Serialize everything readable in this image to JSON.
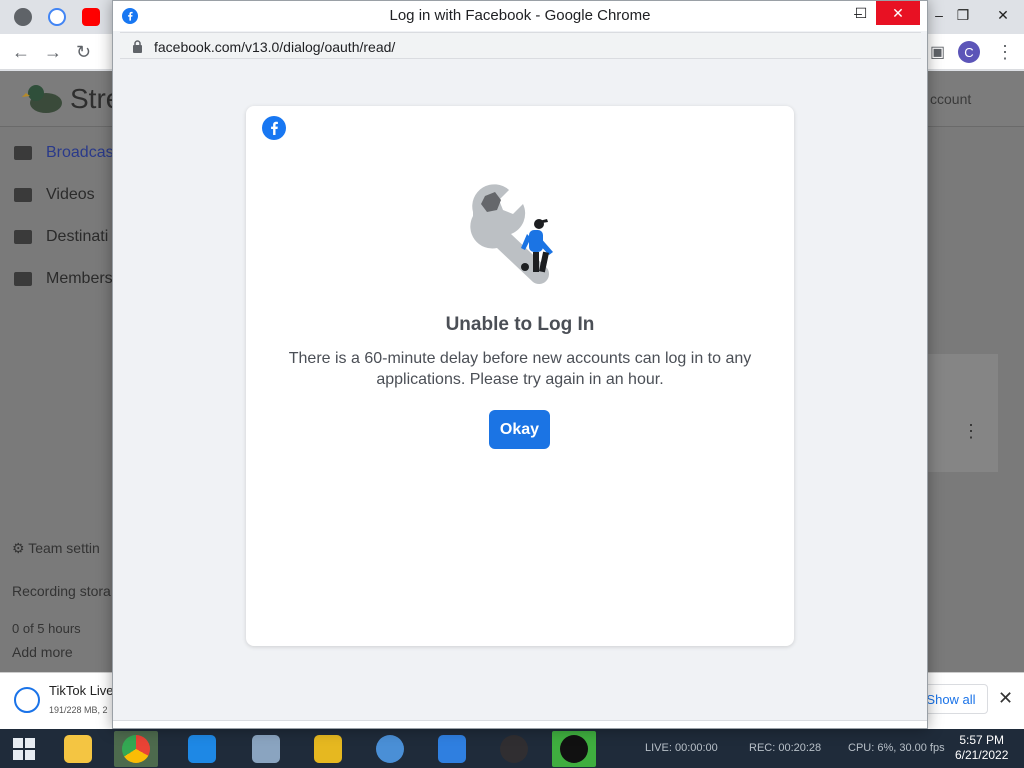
{
  "background": {
    "site_title": "Stre",
    "account_label": "ccount",
    "nav": [
      {
        "label": "Broadcas",
        "icon": "video-camera-icon"
      },
      {
        "label": "Videos",
        "icon": "video-library-icon"
      },
      {
        "label": "Destinati",
        "icon": "share-icon"
      },
      {
        "label": "Members",
        "icon": "people-icon"
      }
    ],
    "team_settings": "Team settin",
    "recording_storage": "Recording stora",
    "storage_used": "0 of 5 hours",
    "add_more": "Add more",
    "avatar_letter": "C"
  },
  "download": {
    "title": "TikTok Live",
    "subtitle": "191/228 MB, 2",
    "show_all": "Show all"
  },
  "popup": {
    "window_title": "Log in with Facebook - Google Chrome",
    "url": "facebook.com/v13.0/dialog/oauth/read/",
    "card": {
      "title": "Unable to Log In",
      "message": "There is a 60-minute delay before new accounts can log in to any applications. Please try again in an hour.",
      "button": "Okay"
    }
  },
  "taskbar": {
    "live": "LIVE: 00:00:00",
    "rec": "REC: 00:20:28",
    "tray_text": "CPU: 6%, 30.00 fps",
    "time": "5:57 PM",
    "date": "6/21/2022"
  },
  "colors": {
    "facebook_blue": "#1877f2",
    "button_blue": "#1b74e4",
    "close_red": "#e81123"
  }
}
